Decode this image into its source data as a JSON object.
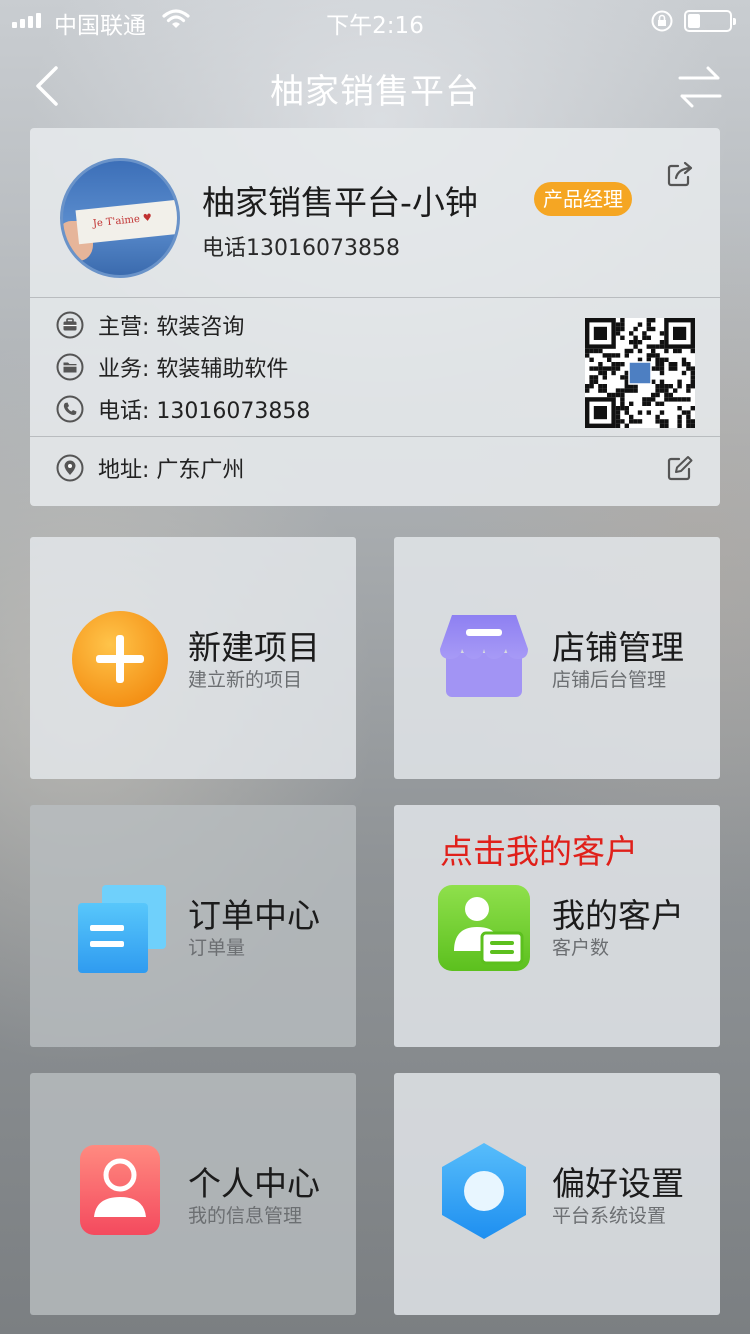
{
  "status_bar": {
    "carrier": "中国联通",
    "time": "下午2:16",
    "battery_level": 0.3
  },
  "nav": {
    "title": "柚家销售平台",
    "back_icon": "chevron-left-icon",
    "switch_icon": "swap-arrows-icon"
  },
  "profile": {
    "name": "柚家销售平台-小钟",
    "role": "产品经理",
    "phone_line": "电话13016073858",
    "avatar_caption": "Je T'aime ♥",
    "main_business": "主营: 软装咨询",
    "business": "业务: 软装辅助软件",
    "phone": "电话: 13016073858",
    "address": "地址: 广东广州"
  },
  "colors": {
    "badge": "#f5a623",
    "callout": "#e0201a"
  },
  "tiles": [
    {
      "title": "新建项目",
      "subtitle": "建立新的项目",
      "icon": "plus-circle-icon"
    },
    {
      "title": "店铺管理",
      "subtitle": "店铺后台管理",
      "icon": "store-icon"
    },
    {
      "title": "订单中心",
      "subtitle": "订单量",
      "icon": "documents-icon"
    },
    {
      "title": "我的客户",
      "subtitle": "客户数",
      "icon": "customer-card-icon",
      "callout": "点击我的客户"
    },
    {
      "title": "个人中心",
      "subtitle": "我的信息管理",
      "icon": "person-icon"
    },
    {
      "title": "偏好设置",
      "subtitle": "平台系统设置",
      "icon": "hexagon-settings-icon"
    }
  ]
}
